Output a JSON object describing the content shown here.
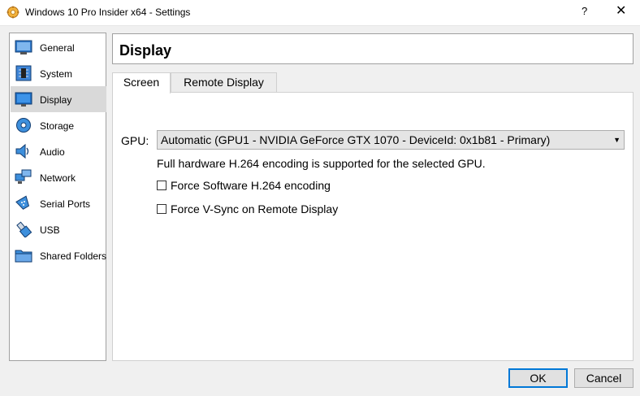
{
  "window": {
    "title": "Windows 10 Pro Insider x64 - Settings",
    "help_label": "?",
    "close_label": "✕"
  },
  "sidebar": {
    "items": [
      {
        "label": "General",
        "icon": "general-icon"
      },
      {
        "label": "System",
        "icon": "system-icon"
      },
      {
        "label": "Display",
        "icon": "display-icon",
        "selected": true
      },
      {
        "label": "Storage",
        "icon": "storage-icon"
      },
      {
        "label": "Audio",
        "icon": "audio-icon"
      },
      {
        "label": "Network",
        "icon": "network-icon"
      },
      {
        "label": "Serial Ports",
        "icon": "serial-ports-icon"
      },
      {
        "label": "USB",
        "icon": "usb-icon"
      },
      {
        "label": "Shared Folders",
        "icon": "shared-folders-icon"
      }
    ]
  },
  "header": {
    "title": "Display"
  },
  "tabs": [
    {
      "label": "Screen",
      "active": true
    },
    {
      "label": "Remote Display",
      "active": false
    }
  ],
  "screen": {
    "gpu_label": "GPU:",
    "gpu_value": "Automatic (GPU1 - NVIDIA GeForce GTX 1070 - DeviceId: 0x1b81 - Primary)",
    "note": "Full hardware H.264 encoding is supported for the selected GPU.",
    "checkboxes": [
      {
        "label": "Force Software H.264 encoding",
        "checked": false
      },
      {
        "label": "Force V-Sync on Remote Display",
        "checked": false
      }
    ]
  },
  "buttons": {
    "ok": "OK",
    "cancel": "Cancel"
  },
  "colors": {
    "accent": "#0078d7",
    "selected_item": "#d9d9d9",
    "window_bg": "#f0f0f0"
  }
}
